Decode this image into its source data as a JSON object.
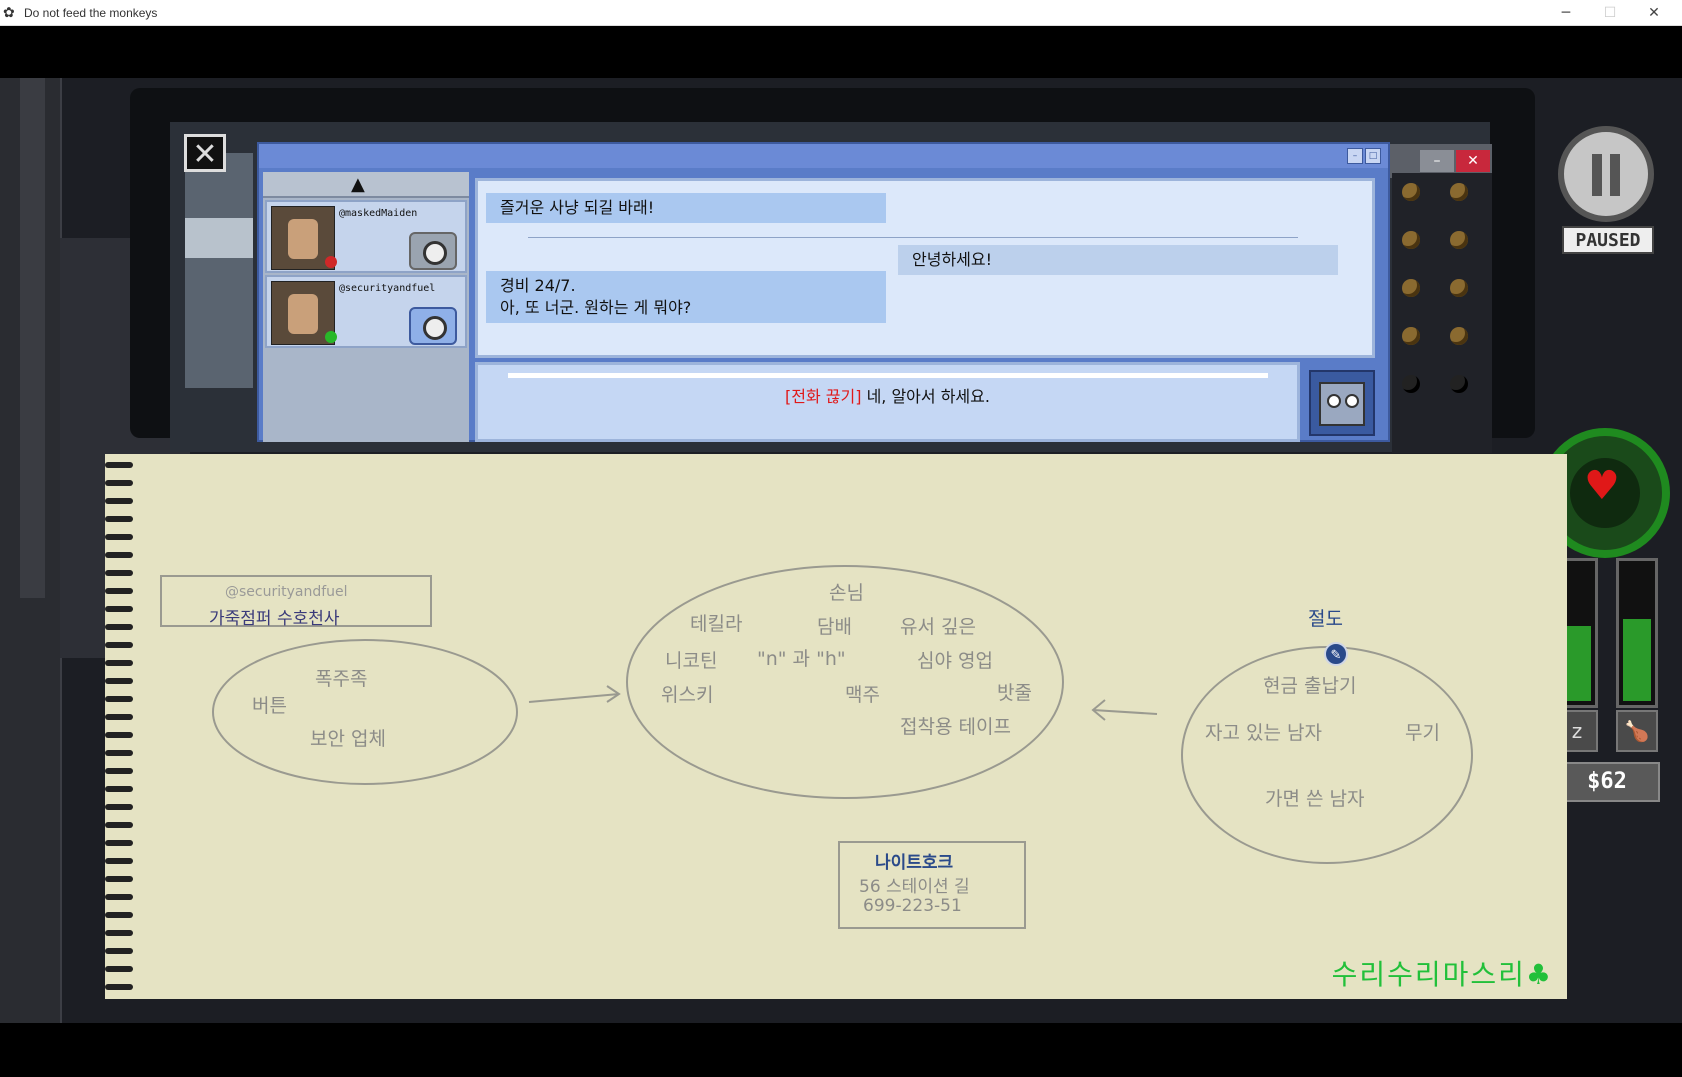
{
  "window": {
    "title": "Do not feed the monkeys",
    "controls": {
      "minimize": "─",
      "maximize": "☐",
      "close": "✕"
    }
  },
  "chat": {
    "contacts": [
      {
        "handle": "@maskedMaiden",
        "status_color": "#d02828"
      },
      {
        "handle": "@securityandfuel",
        "status_color": "#28b828"
      }
    ],
    "messages": [
      {
        "side": "left",
        "text": "즐거운 사냥 되길 바래!"
      },
      {
        "side": "right",
        "text": "안녕하세요!"
      },
      {
        "side": "left",
        "line1": "경비 24/7.",
        "line2": "아, 또 너군. 원하는 게 뭐야?"
      }
    ],
    "reply": {
      "prefix": "[전화 끊기]",
      "text": " 네, 알아서 하세요."
    }
  },
  "hud": {
    "paused_label": "PAUSED",
    "money": "$62",
    "sleep_level": 0.55,
    "hunger_level": 0.6,
    "health_level": 0.85,
    "sleep_icon": "zz-sleep-icon",
    "food_icon": "drumstick-icon"
  },
  "notebook": {
    "left_card": {
      "handle": "@securityandfuel",
      "title": "가죽점퍼 수호천사"
    },
    "left_bubble": [
      "폭주족",
      "버튼",
      "보안 업체"
    ],
    "center_bubble": [
      "손님",
      "테킬라",
      "담배",
      "유서 깊은",
      "니코틴",
      "\"n\" 과 \"h\"",
      "심야 영업",
      "위스키",
      "맥주",
      "밧줄",
      "접착용 테이프"
    ],
    "center_card": {
      "name": "나이트호크",
      "address": "56 스테이션 길",
      "phone": "699-223-51"
    },
    "right_title": "절도",
    "right_bubble": [
      "현금 출납기",
      "자고 있는 남자",
      "무기",
      "가면 쓴 남자"
    ],
    "signature": "수리수리마스리"
  },
  "colors": {
    "accent_blue": "#5a7cc8",
    "notebook_paper": "#e5e3c3",
    "health_green": "#1f8a1f",
    "hangup_red": "#e01818"
  }
}
